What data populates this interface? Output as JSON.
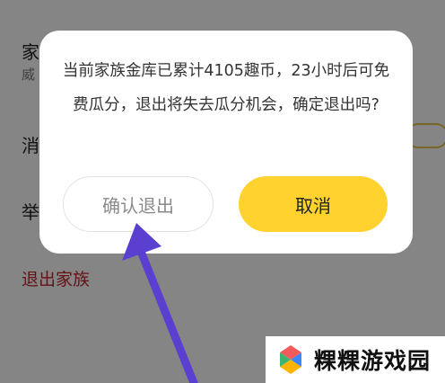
{
  "background": {
    "row1_label": "家",
    "row1_sub": "威",
    "row2_label": "消",
    "row3_label": "举",
    "exit_family_link": "退出家族"
  },
  "dialog": {
    "message": "当前家族金库已累计4105趣币，23小时后可免费瓜分，退出将失去瓜分机会，确定退出吗?",
    "confirm_label": "确认退出",
    "cancel_label": "取消"
  },
  "watermark": {
    "text": "粿粿游戏园",
    "logo_icon": "colorful-s-logo-icon"
  },
  "colors": {
    "accent_yellow": "#ffd22f",
    "exit_red": "#c2262b",
    "arrow_purple": "#5a3fd0"
  }
}
